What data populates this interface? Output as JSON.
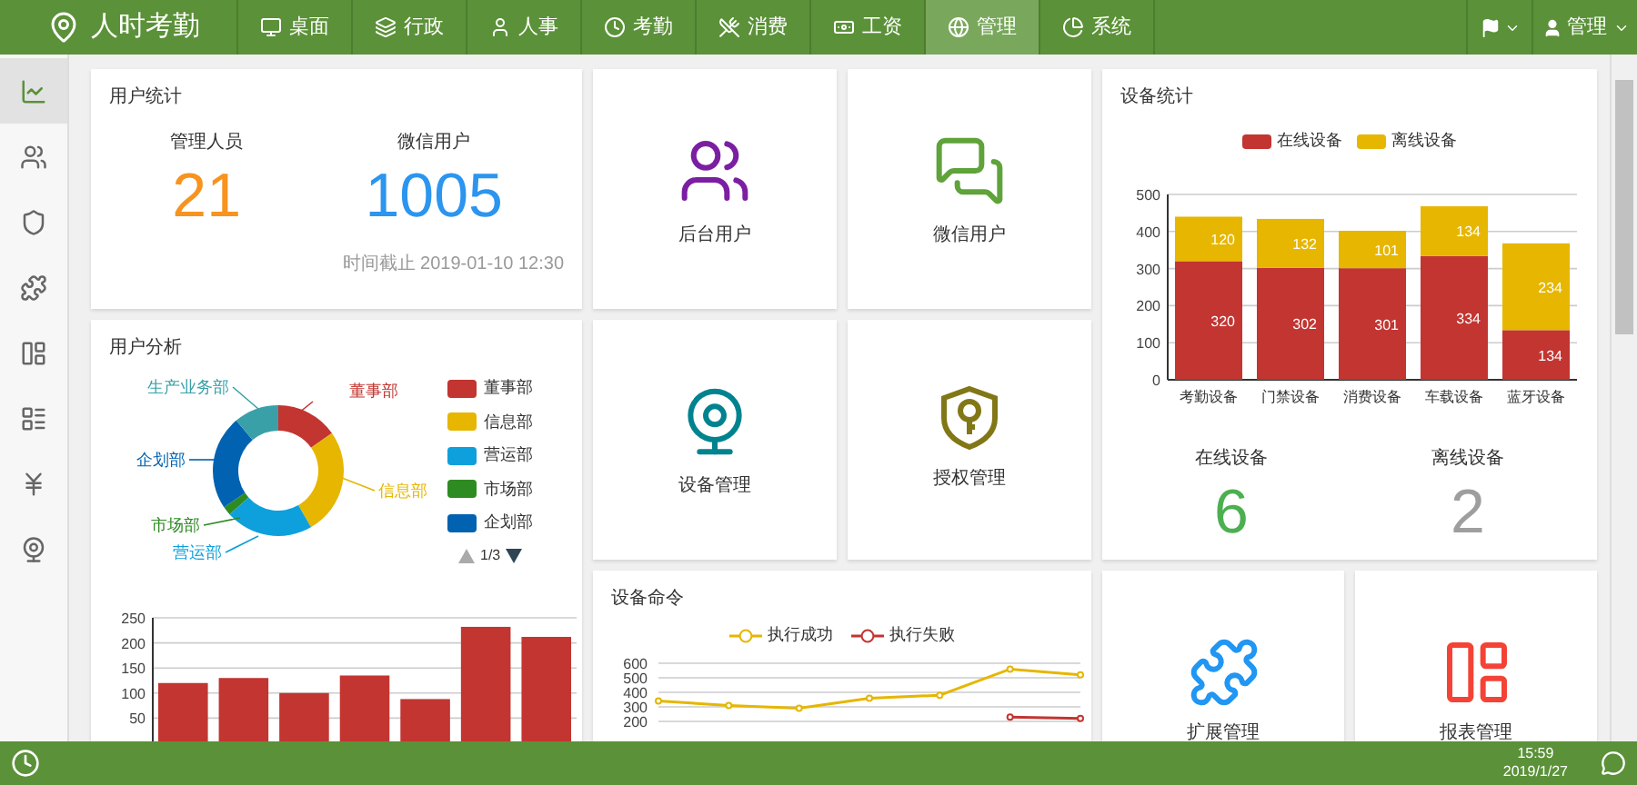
{
  "app": {
    "title": "人时考勤"
  },
  "nav": [
    {
      "label": "桌面",
      "selected": false
    },
    {
      "label": "行政",
      "selected": false
    },
    {
      "label": "人事",
      "selected": false
    },
    {
      "label": "考勤",
      "selected": false
    },
    {
      "label": "消费",
      "selected": false
    },
    {
      "label": "工资",
      "selected": false
    },
    {
      "label": "管理",
      "selected": true
    },
    {
      "label": "系统",
      "selected": false
    }
  ],
  "user_menu": {
    "label": "管理"
  },
  "sidebar": [
    {
      "selected": true
    },
    {
      "selected": false
    },
    {
      "selected": false
    },
    {
      "selected": false
    },
    {
      "selected": false
    },
    {
      "selected": false
    },
    {
      "selected": false
    },
    {
      "selected": false
    }
  ],
  "user_stats": {
    "title": "用户统计",
    "stats": [
      {
        "label": "管理人员",
        "value": "21",
        "color": "#f7931e"
      },
      {
        "label": "微信用户",
        "value": "1005",
        "color": "#2b95ef"
      }
    ],
    "footnote": "时间截止 2019-01-10 12:30"
  },
  "tiles": [
    {
      "label": "后台用户",
      "color": "#7b1fa2"
    },
    {
      "label": "微信用户",
      "color": "#5fa33a"
    },
    {
      "label": "设备管理",
      "color": "#00838f"
    },
    {
      "label": "授权管理",
      "color": "#827717"
    }
  ],
  "device_stats": {
    "title": "设备统计",
    "chart_data": {
      "type": "bar",
      "stacked": true,
      "grid": true,
      "data_labels": true,
      "categories": [
        "考勤设备",
        "门禁设备",
        "消费设备",
        "车载设备",
        "蓝牙设备"
      ],
      "ylim": [
        0,
        500
      ],
      "yticks": [
        0,
        100,
        200,
        300,
        400,
        500
      ],
      "series": [
        {
          "name": "在线设备",
          "color": "#c23531",
          "values": [
            320,
            302,
            301,
            334,
            134
          ]
        },
        {
          "name": "离线设备",
          "color": "#e6b600",
          "values": [
            120,
            132,
            101,
            134,
            234
          ]
        }
      ]
    },
    "counts": [
      {
        "label": "在线设备",
        "value": "6",
        "color": "#4caf50"
      },
      {
        "label": "离线设备",
        "value": "2",
        "color": "#9e9e9e"
      }
    ]
  },
  "user_analysis": {
    "title": "用户分析",
    "donut_labels": [
      {
        "label": "董事部",
        "color": "#c23531"
      },
      {
        "label": "信息部",
        "color": "#e6b600"
      },
      {
        "label": "营运部",
        "color": "#0ea0dc"
      },
      {
        "label": "市场部",
        "color": "#2e8b22"
      },
      {
        "label": "企划部",
        "color": "#0062b0"
      },
      {
        "label": "生产业务部",
        "color": "#3aa0a8"
      }
    ],
    "legend": [
      {
        "label": "董事部",
        "color": "#c23531"
      },
      {
        "label": "信息部",
        "color": "#e6b600"
      },
      {
        "label": "营运部",
        "color": "#0ea0dc"
      },
      {
        "label": "市场部",
        "color": "#2e8b22"
      },
      {
        "label": "企划部",
        "color": "#0062b0"
      }
    ],
    "pager": "1/3",
    "chart_data": {
      "type": "bar",
      "grid": true,
      "values": [
        120,
        130,
        100,
        135,
        88,
        232,
        212
      ],
      "ylim": [
        0,
        250
      ],
      "yticks": [
        50,
        100,
        150,
        200,
        250
      ]
    }
  },
  "device_commands": {
    "title": "设备命令",
    "chart_data": {
      "type": "line",
      "grid": true,
      "ylim": [
        200,
        600
      ],
      "yticks": [
        200,
        300,
        400,
        500,
        600
      ],
      "series": [
        {
          "name": "执行成功",
          "color": "#e6b600",
          "marker": true,
          "values": [
            340,
            310,
            290,
            360,
            380,
            560,
            520
          ]
        },
        {
          "name": "执行失败",
          "color": "#c23531",
          "marker": true,
          "values": [
            null,
            null,
            null,
            null,
            null,
            230,
            220
          ]
        }
      ]
    }
  },
  "bottom_tiles": [
    {
      "label": "扩展管理",
      "color": "#2196f3"
    },
    {
      "label": "报表管理",
      "color": "#f44336"
    }
  ],
  "status": {
    "time": "15:59",
    "date": "2019/1/27"
  }
}
